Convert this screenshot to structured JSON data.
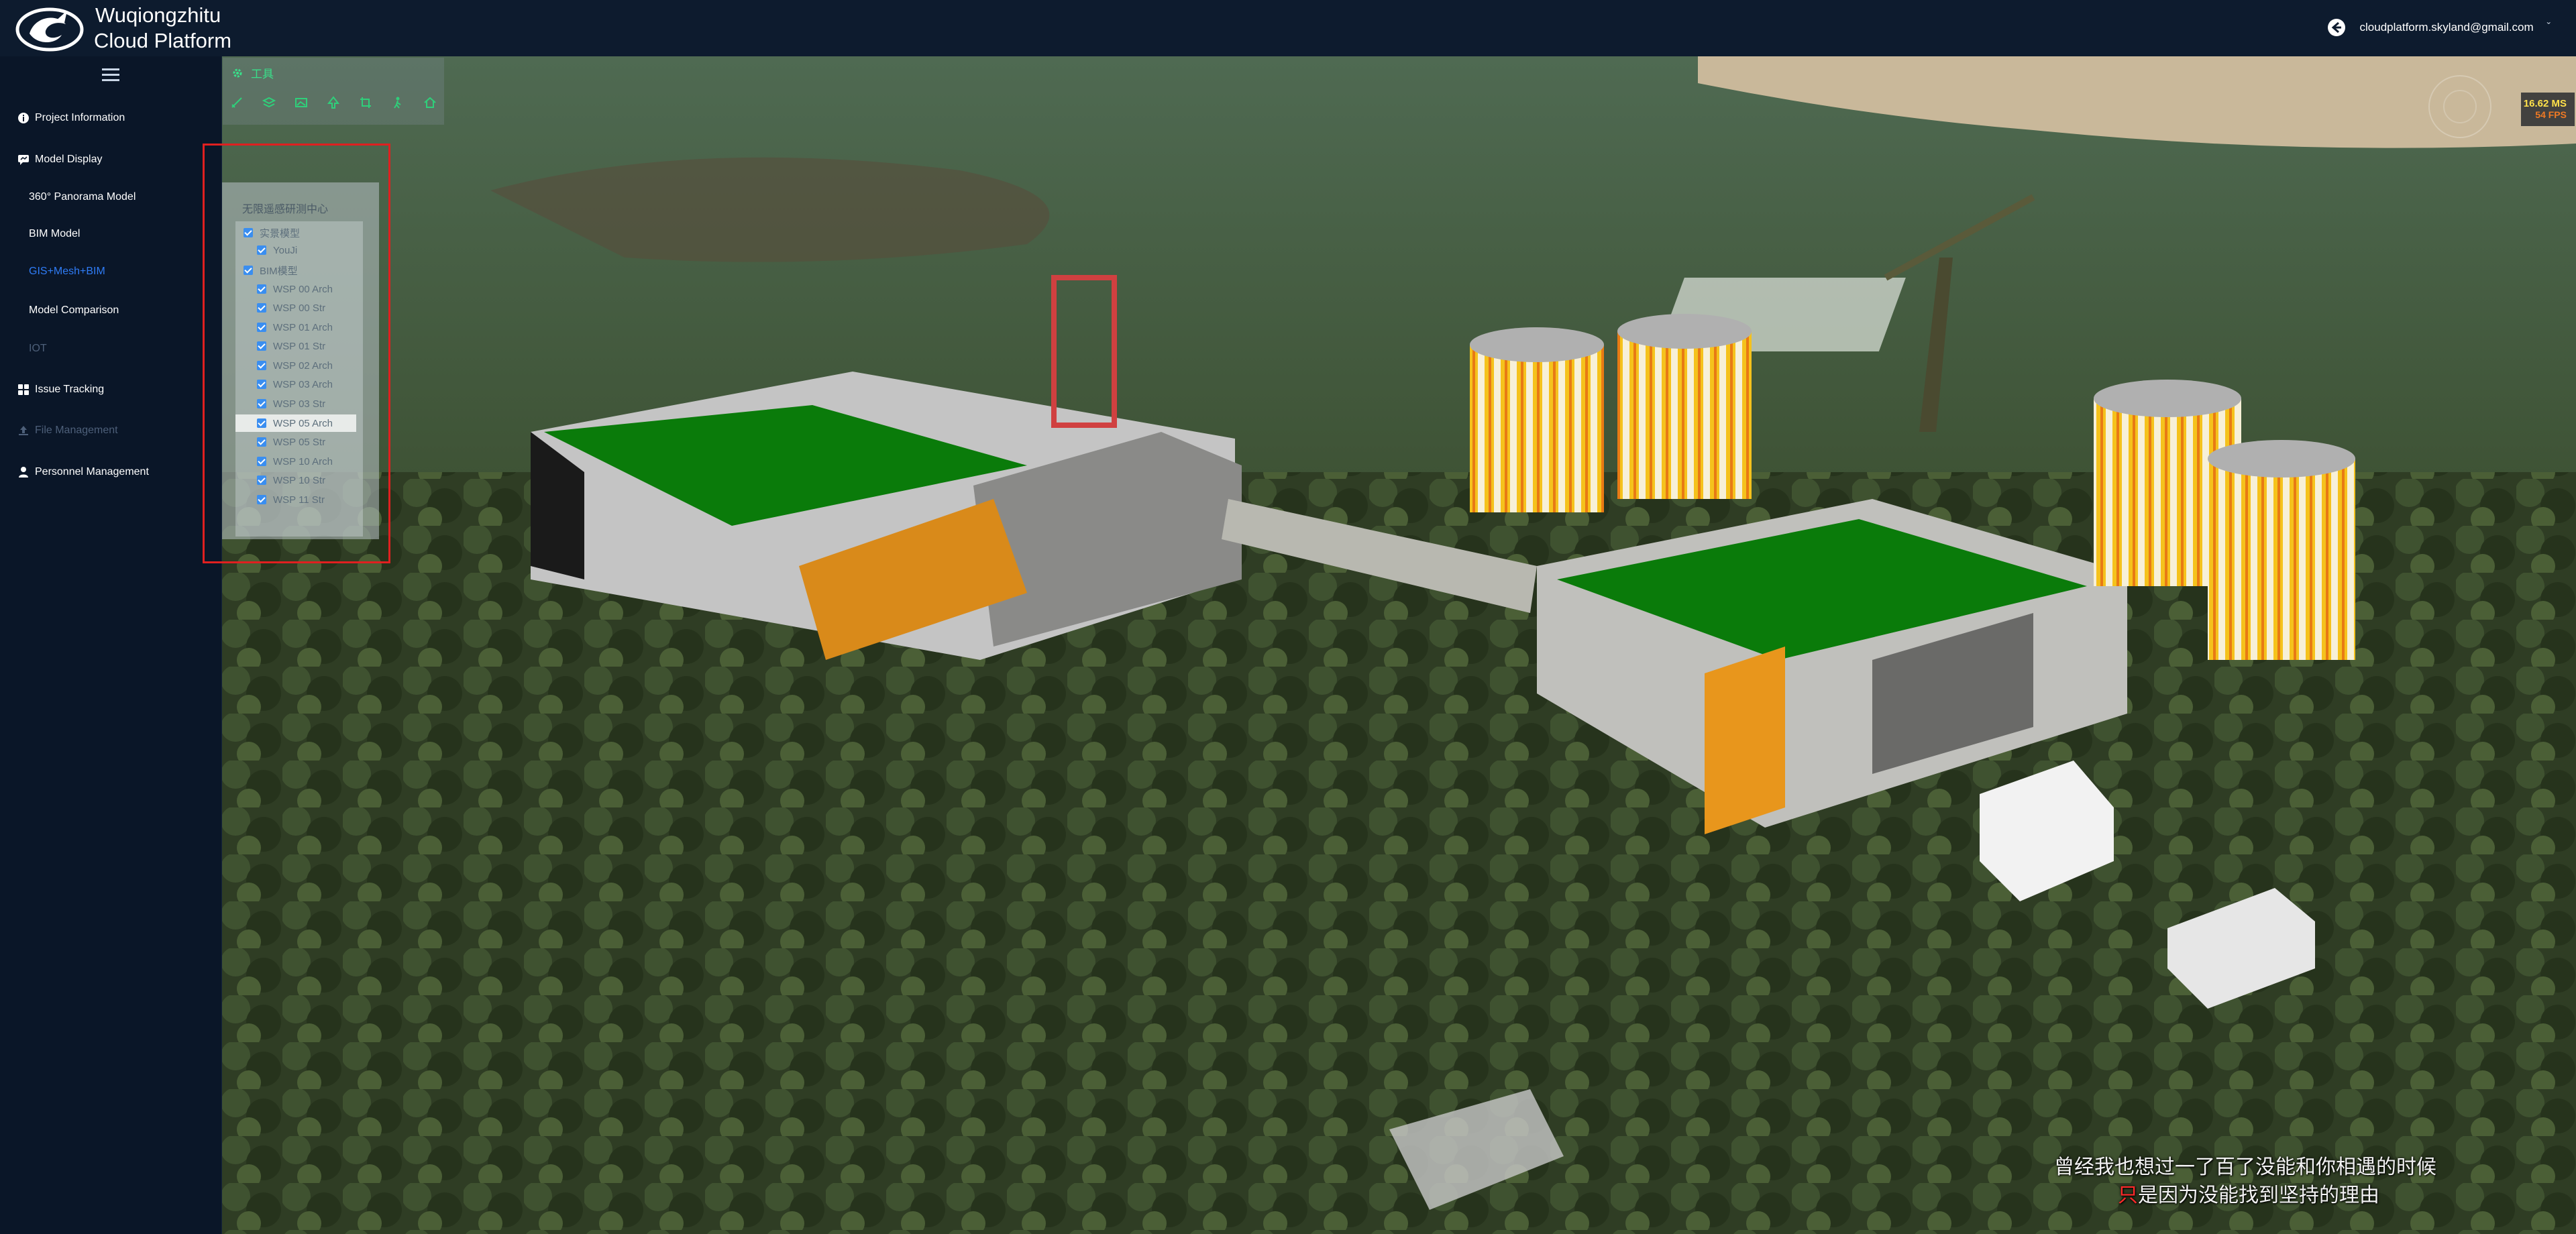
{
  "header": {
    "brand_line1": "Wuqiongzhitu",
    "brand_line2": "Cloud Platform",
    "user_email": "cloudplatform.skyland@gmail.com",
    "caret": "ˇ",
    "icons": {
      "logo": "dragon-logo",
      "back": "back-arrow-icon",
      "caret": "chevron-down-icon"
    }
  },
  "sidebar": {
    "toggle_icon": "hamburger-menu-icon",
    "items": [
      {
        "label": "Project Information",
        "icon": "info-circle-icon",
        "state": "normal"
      },
      {
        "label": "Model Display",
        "icon": "model-display-icon",
        "state": "normal"
      },
      {
        "label": "360° Panorama Model",
        "icon": "",
        "state": "normal"
      },
      {
        "label": "BIM Model",
        "icon": "",
        "state": "normal"
      },
      {
        "label": "GIS+Mesh+BIM",
        "icon": "",
        "state": "active"
      },
      {
        "label": "Model Comparison",
        "icon": "",
        "state": "normal"
      },
      {
        "label": "IOT",
        "icon": "",
        "state": "disabled"
      },
      {
        "label": "Issue Tracking",
        "icon": "grid-icon",
        "state": "normal"
      },
      {
        "label": "File Management",
        "icon": "upload-icon",
        "state": "disabled"
      },
      {
        "label": "Personnel Management",
        "icon": "person-icon",
        "state": "normal"
      }
    ]
  },
  "toolbar": {
    "title": "工具",
    "title_icon": "gear-icon",
    "tools": [
      "measure-icon",
      "layers-icon",
      "image-icon",
      "tree-icon",
      "clip-icon",
      "walk-icon",
      "home-icon"
    ]
  },
  "model_tree": {
    "title": "无限遥感研测中心",
    "items": [
      {
        "label": "实景模型",
        "level": 1,
        "checked": true
      },
      {
        "label": "YouJi",
        "level": 2,
        "checked": true
      },
      {
        "label": "BIM模型",
        "level": 1,
        "checked": true
      },
      {
        "label": "WSP 00 Arch",
        "level": 2,
        "checked": true
      },
      {
        "label": "WSP 00 Str",
        "level": 2,
        "checked": true
      },
      {
        "label": "WSP 01 Arch",
        "level": 2,
        "checked": true
      },
      {
        "label": "WSP 01 Str",
        "level": 2,
        "checked": true
      },
      {
        "label": "WSP 02 Arch",
        "level": 2,
        "checked": true
      },
      {
        "label": "WSP 03 Arch",
        "level": 2,
        "checked": true
      },
      {
        "label": "WSP 03 Str",
        "level": 2,
        "checked": true
      },
      {
        "label": "WSP 05 Arch",
        "level": 2,
        "checked": true,
        "highlighted": true
      },
      {
        "label": "WSP 05 Str",
        "level": 2,
        "checked": true
      },
      {
        "label": "WSP 10 Arch",
        "level": 2,
        "checked": true
      },
      {
        "label": "WSP 10 Str",
        "level": 2,
        "checked": true
      },
      {
        "label": "WSP 11 Str",
        "level": 2,
        "checked": true
      }
    ]
  },
  "performance": {
    "ms": "16.62 MS",
    "fps": "54 FPS"
  },
  "subtitles": {
    "line1": "曾经我也想过一了百了没能和你相遇的时候",
    "line2_red": "只",
    "line2_rest": "是因为没能找到坚持的理由"
  },
  "colors": {
    "accent_active": "#2f7cf6",
    "toolbar_title": "#39e08a",
    "highlight_frame": "#e02020",
    "checkbox": "#3a8ef0"
  }
}
